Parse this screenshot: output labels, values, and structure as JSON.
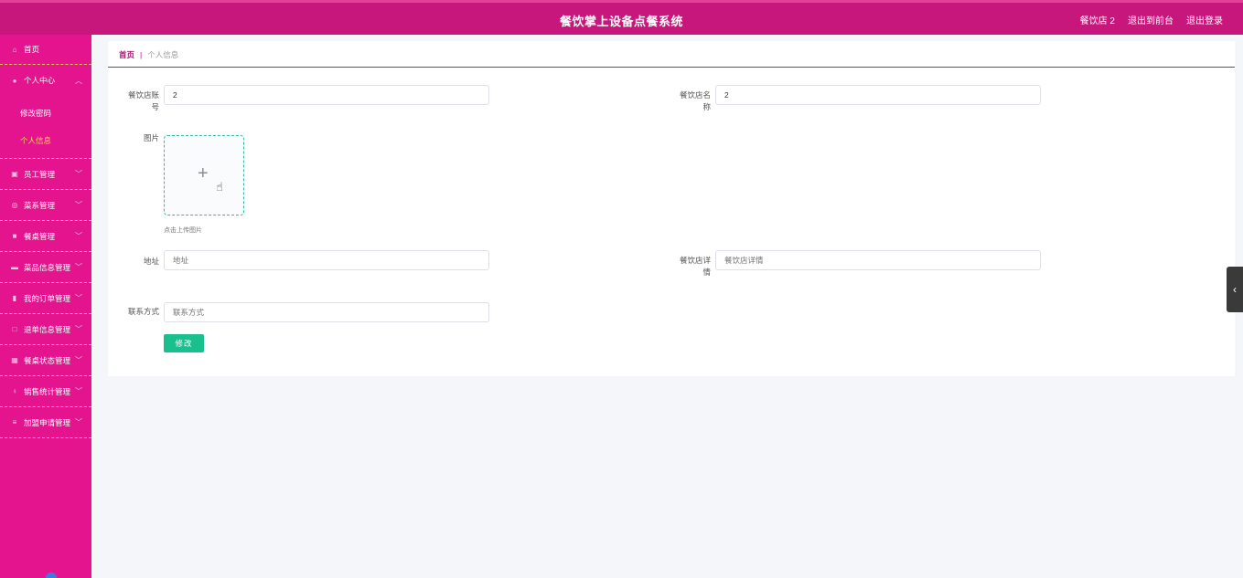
{
  "header": {
    "title": "餐饮掌上设备点餐系统",
    "user_label": "餐饮店 2",
    "to_front_label": "退出到前台",
    "logout_label": "退出登录"
  },
  "sidebar": {
    "items": [
      {
        "label": "首页",
        "icon": "home-icon"
      },
      {
        "label": "个人中心",
        "icon": "user-icon",
        "expanded": true,
        "children": [
          {
            "label": "修改密码"
          },
          {
            "label": "个人信息",
            "active": true
          }
        ]
      },
      {
        "label": "员工管理",
        "icon": "briefcase-icon"
      },
      {
        "label": "菜系管理",
        "icon": "globe-icon"
      },
      {
        "label": "餐桌管理",
        "icon": "table-icon"
      },
      {
        "label": "菜品信息管理",
        "icon": "message-icon"
      },
      {
        "label": "我的订单管理",
        "icon": "bar-chart-icon"
      },
      {
        "label": "退单信息管理",
        "icon": "square-icon"
      },
      {
        "label": "餐桌状态管理",
        "icon": "grid-icon"
      },
      {
        "label": "销售统计管理",
        "icon": "mic-icon"
      },
      {
        "label": "加盟申请管理",
        "icon": "list-icon"
      }
    ]
  },
  "breadcrumb": {
    "home": "首页",
    "separator": "|",
    "current": "个人信息"
  },
  "form": {
    "account_label": "餐饮店账号",
    "account_value": "2",
    "name_label": "餐饮店名称",
    "name_value": "2",
    "image_label": "图片",
    "upload_tip": "点击上传图片",
    "address_label": "地址",
    "address_placeholder": "地址",
    "detail_label": "餐饮店详情",
    "detail_placeholder": "餐饮店详情",
    "contact_label": "联系方式",
    "contact_placeholder": "联系方式",
    "submit_label": "修改"
  },
  "colors": {
    "header": "#c8177c",
    "sidebar": "#e4148f",
    "active_item": "#ffd84a",
    "primary_button": "#19c08e"
  }
}
